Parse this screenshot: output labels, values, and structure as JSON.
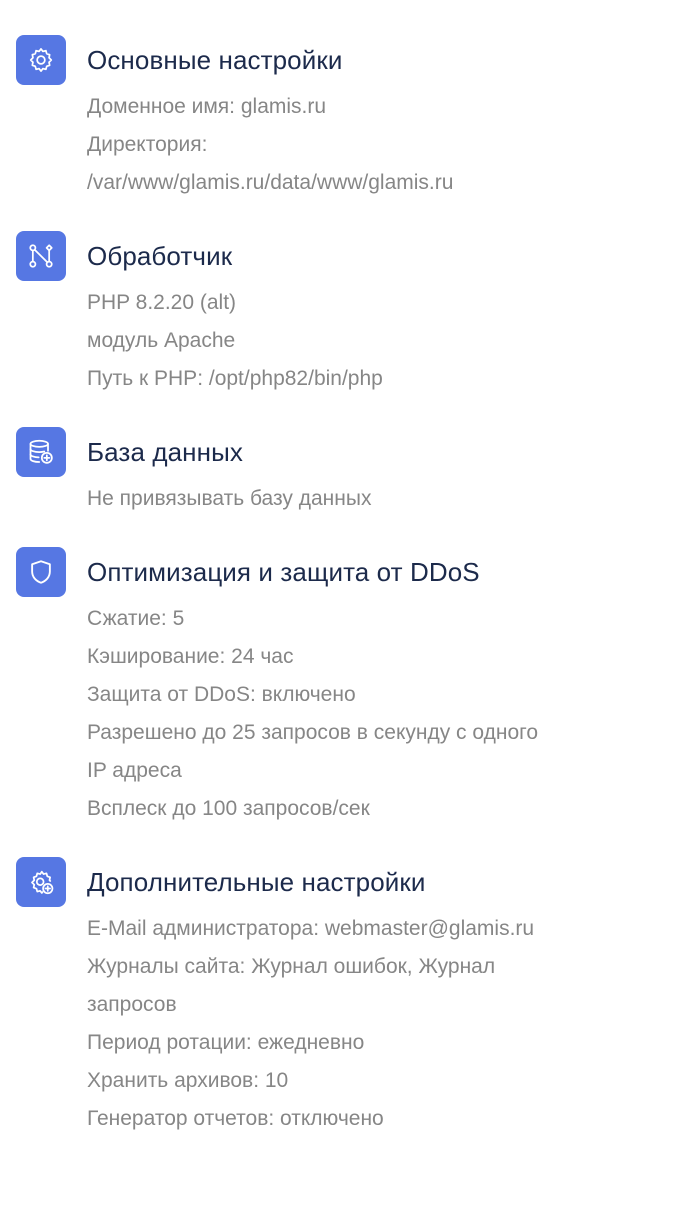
{
  "sections": [
    {
      "icon": "gear-icon",
      "title": "Основные настройки",
      "lines": [
        "Доменное имя: glamis.ru",
        "Директория:",
        "/var/www/glamis.ru/data/www/glamis.ru"
      ]
    },
    {
      "icon": "flow-branch-icon",
      "title": "Обработчик",
      "lines": [
        "PHP 8.2.20 (alt)",
        "модуль Apache",
        "Путь к PHP: /opt/php82/bin/php"
      ]
    },
    {
      "icon": "database-add-icon",
      "title": "База данных",
      "lines": [
        "Не привязывать базу данных"
      ]
    },
    {
      "icon": "shield-icon",
      "title": "Оптимизация и защита от DDoS",
      "lines": [
        "Сжатие: 5",
        "Кэширование: 24 час",
        "Защита от DDoS: включено",
        "Разрешено до 25 запросов в секунду с одного",
        "IP адреса",
        "Всплеск до 100 запросов/сек"
      ]
    },
    {
      "icon": "gear-add-icon",
      "title": "Дополнительные настройки",
      "lines": [
        "E-Mail администратора: webmaster@glamis.ru",
        "Журналы сайта: Журнал ошибок, Журнал",
        "запросов",
        "Период ротации: ежедневно",
        "Хранить архивов: 10",
        "Генератор отчетов: отключено"
      ]
    }
  ],
  "colors": {
    "icon_bg": "#5677e3",
    "title": "#1c2a4b",
    "text": "#868686"
  }
}
